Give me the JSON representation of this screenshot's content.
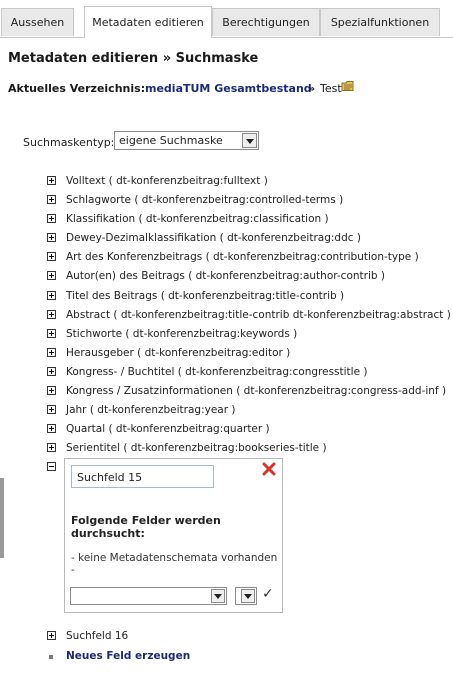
{
  "tabs": [
    {
      "label": "Aussehen"
    },
    {
      "label": "Metadaten editieren"
    },
    {
      "label": "Berechtigungen"
    },
    {
      "label": "Spezialfunktionen"
    }
  ],
  "breadcrumb": "Metadaten editieren » Suchmaske",
  "current_dir": {
    "label": "Aktuelles Verzeichnis:",
    "link": "mediaTUM Gesamtbestand",
    "separator": "»",
    "rest": "Test",
    "icon": "folder-edit-icon"
  },
  "mask_type": {
    "label": "Suchmaskentyp:",
    "selected": "eigene Suchmaske"
  },
  "fields": [
    {
      "label": "Volltext ( dt-konferenzbeitrag:fulltext )"
    },
    {
      "label": "Schlagworte ( dt-konferenzbeitrag:controlled-terms )"
    },
    {
      "label": "Klassifikation ( dt-konferenzbeitrag:classification )"
    },
    {
      "label": "Dewey-Dezimalklassifikation ( dt-konferenzbeitrag:ddc )"
    },
    {
      "label": "Art des Konferenzbeitrags ( dt-konferenzbeitrag:contribution-type )"
    },
    {
      "label": "Autor(en) des Beitrags ( dt-konferenzbeitrag:author-contrib )"
    },
    {
      "label": "Titel des Beitrags ( dt-konferenzbeitrag:title-contrib )"
    },
    {
      "label": "Abstract ( dt-konferenzbeitrag:title-contrib dt-konferenzbeitrag:abstract )"
    },
    {
      "label": "Stichworte ( dt-konferenzbeitrag:keywords )"
    },
    {
      "label": "Herausgeber ( dt-konferenzbeitrag:editor )"
    },
    {
      "label": "Kongress- / Buchtitel ( dt-konferenzbeitrag:congresstitle )"
    },
    {
      "label": "Kongress / Zusatzinformationen ( dt-konferenzbeitrag:congress-add-inf )"
    },
    {
      "label": "Jahr ( dt-konferenzbeitrag:year )"
    },
    {
      "label": "Quartal ( dt-konferenzbeitrag:quarter )"
    },
    {
      "label": "Serientitel ( dt-konferenzbeitrag:bookseries-title )"
    }
  ],
  "edit_panel": {
    "name_value": "Suchfeld 15",
    "title": "Folgende Felder werden durchsucht:",
    "note": "- keine Metadatenschemata vorhanden -",
    "schema_select": "",
    "field_select": ""
  },
  "field16": {
    "label": "Suchfeld 16"
  },
  "new_field": {
    "label": "Neues Feld erzeugen"
  },
  "colors": {
    "link": "#1b2a73",
    "close_red": "#d9322b",
    "tab_bg": "#e9e9e9"
  }
}
